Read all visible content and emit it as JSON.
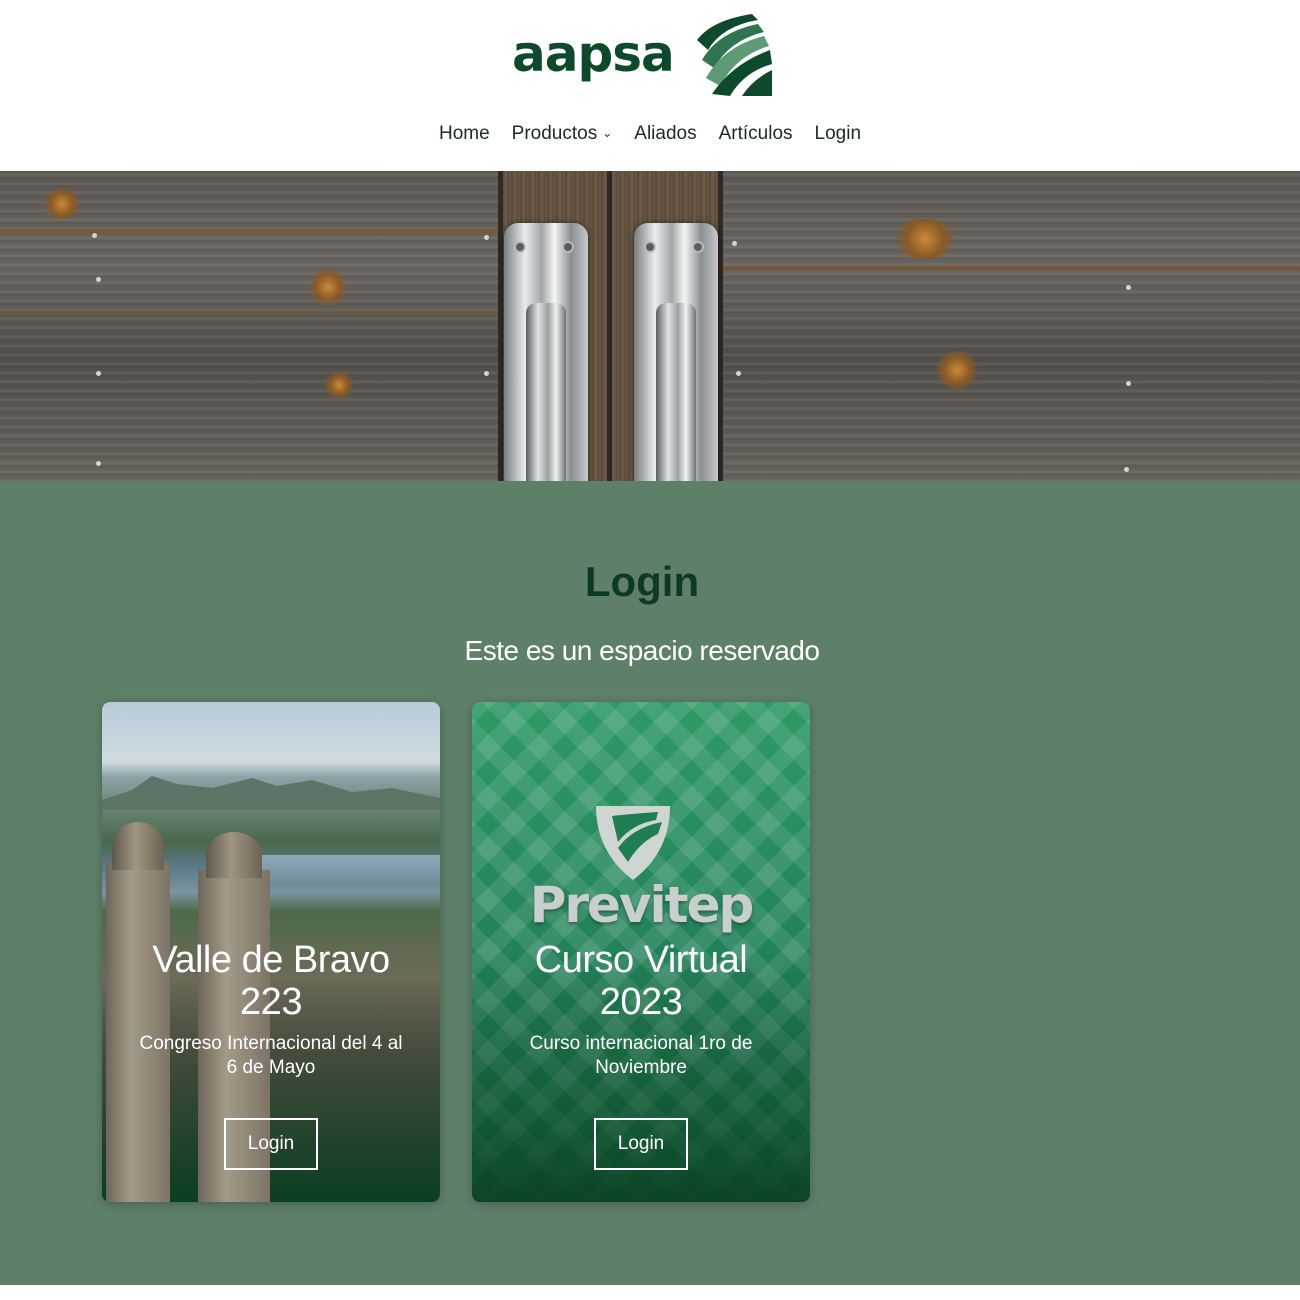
{
  "brand": {
    "logo_text": "aapsa",
    "color": "#0d4a2b"
  },
  "nav": {
    "items": [
      {
        "label": "Home"
      },
      {
        "label": "Productos",
        "has_dropdown": true,
        "icon": "chevron-down-icon"
      },
      {
        "label": "Aliados"
      },
      {
        "label": "Artículos"
      },
      {
        "label": "Login"
      }
    ]
  },
  "hero": {
    "image": "weathered wooden doors with metal handles"
  },
  "section": {
    "title": "Login",
    "subtitle": "Este es un espacio reservado",
    "background": "#5e8069",
    "title_color": "#0d3b22"
  },
  "cards": [
    {
      "title": "Valle de Bravo 223",
      "description": "Congreso Internacional del 4 al 6 de Mayo",
      "button_label": "Login"
    },
    {
      "logo_text": "Previtep",
      "title": "Curso Virtual 2023",
      "description": "Curso internacional  1ro de Noviembre",
      "button_label": "Login"
    }
  ]
}
